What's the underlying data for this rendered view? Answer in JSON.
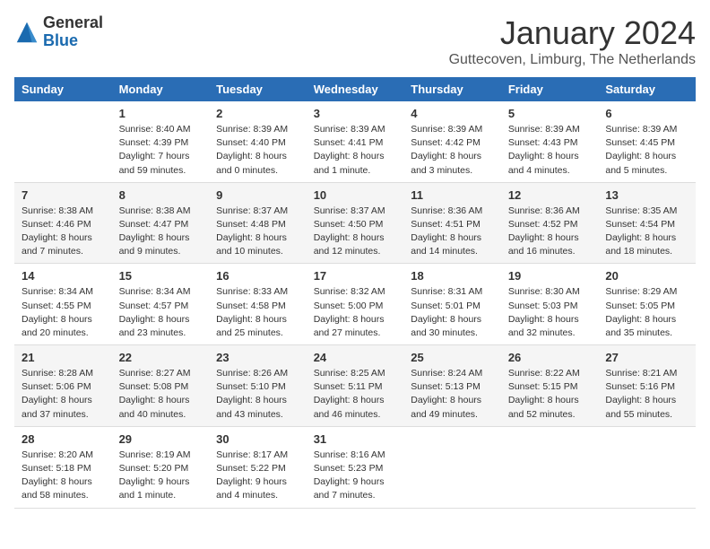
{
  "logo": {
    "general": "General",
    "blue": "Blue"
  },
  "title": "January 2024",
  "location": "Guttecoven, Limburg, The Netherlands",
  "days_header": [
    "Sunday",
    "Monday",
    "Tuesday",
    "Wednesday",
    "Thursday",
    "Friday",
    "Saturday"
  ],
  "weeks": [
    [
      {
        "num": "",
        "info": ""
      },
      {
        "num": "1",
        "info": "Sunrise: 8:40 AM\nSunset: 4:39 PM\nDaylight: 7 hours\nand 59 minutes."
      },
      {
        "num": "2",
        "info": "Sunrise: 8:39 AM\nSunset: 4:40 PM\nDaylight: 8 hours\nand 0 minutes."
      },
      {
        "num": "3",
        "info": "Sunrise: 8:39 AM\nSunset: 4:41 PM\nDaylight: 8 hours\nand 1 minute."
      },
      {
        "num": "4",
        "info": "Sunrise: 8:39 AM\nSunset: 4:42 PM\nDaylight: 8 hours\nand 3 minutes."
      },
      {
        "num": "5",
        "info": "Sunrise: 8:39 AM\nSunset: 4:43 PM\nDaylight: 8 hours\nand 4 minutes."
      },
      {
        "num": "6",
        "info": "Sunrise: 8:39 AM\nSunset: 4:45 PM\nDaylight: 8 hours\nand 5 minutes."
      }
    ],
    [
      {
        "num": "7",
        "info": "Sunrise: 8:38 AM\nSunset: 4:46 PM\nDaylight: 8 hours\nand 7 minutes."
      },
      {
        "num": "8",
        "info": "Sunrise: 8:38 AM\nSunset: 4:47 PM\nDaylight: 8 hours\nand 9 minutes."
      },
      {
        "num": "9",
        "info": "Sunrise: 8:37 AM\nSunset: 4:48 PM\nDaylight: 8 hours\nand 10 minutes."
      },
      {
        "num": "10",
        "info": "Sunrise: 8:37 AM\nSunset: 4:50 PM\nDaylight: 8 hours\nand 12 minutes."
      },
      {
        "num": "11",
        "info": "Sunrise: 8:36 AM\nSunset: 4:51 PM\nDaylight: 8 hours\nand 14 minutes."
      },
      {
        "num": "12",
        "info": "Sunrise: 8:36 AM\nSunset: 4:52 PM\nDaylight: 8 hours\nand 16 minutes."
      },
      {
        "num": "13",
        "info": "Sunrise: 8:35 AM\nSunset: 4:54 PM\nDaylight: 8 hours\nand 18 minutes."
      }
    ],
    [
      {
        "num": "14",
        "info": "Sunrise: 8:34 AM\nSunset: 4:55 PM\nDaylight: 8 hours\nand 20 minutes."
      },
      {
        "num": "15",
        "info": "Sunrise: 8:34 AM\nSunset: 4:57 PM\nDaylight: 8 hours\nand 23 minutes."
      },
      {
        "num": "16",
        "info": "Sunrise: 8:33 AM\nSunset: 4:58 PM\nDaylight: 8 hours\nand 25 minutes."
      },
      {
        "num": "17",
        "info": "Sunrise: 8:32 AM\nSunset: 5:00 PM\nDaylight: 8 hours\nand 27 minutes."
      },
      {
        "num": "18",
        "info": "Sunrise: 8:31 AM\nSunset: 5:01 PM\nDaylight: 8 hours\nand 30 minutes."
      },
      {
        "num": "19",
        "info": "Sunrise: 8:30 AM\nSunset: 5:03 PM\nDaylight: 8 hours\nand 32 minutes."
      },
      {
        "num": "20",
        "info": "Sunrise: 8:29 AM\nSunset: 5:05 PM\nDaylight: 8 hours\nand 35 minutes."
      }
    ],
    [
      {
        "num": "21",
        "info": "Sunrise: 8:28 AM\nSunset: 5:06 PM\nDaylight: 8 hours\nand 37 minutes."
      },
      {
        "num": "22",
        "info": "Sunrise: 8:27 AM\nSunset: 5:08 PM\nDaylight: 8 hours\nand 40 minutes."
      },
      {
        "num": "23",
        "info": "Sunrise: 8:26 AM\nSunset: 5:10 PM\nDaylight: 8 hours\nand 43 minutes."
      },
      {
        "num": "24",
        "info": "Sunrise: 8:25 AM\nSunset: 5:11 PM\nDaylight: 8 hours\nand 46 minutes."
      },
      {
        "num": "25",
        "info": "Sunrise: 8:24 AM\nSunset: 5:13 PM\nDaylight: 8 hours\nand 49 minutes."
      },
      {
        "num": "26",
        "info": "Sunrise: 8:22 AM\nSunset: 5:15 PM\nDaylight: 8 hours\nand 52 minutes."
      },
      {
        "num": "27",
        "info": "Sunrise: 8:21 AM\nSunset: 5:16 PM\nDaylight: 8 hours\nand 55 minutes."
      }
    ],
    [
      {
        "num": "28",
        "info": "Sunrise: 8:20 AM\nSunset: 5:18 PM\nDaylight: 8 hours\nand 58 minutes."
      },
      {
        "num": "29",
        "info": "Sunrise: 8:19 AM\nSunset: 5:20 PM\nDaylight: 9 hours\nand 1 minute."
      },
      {
        "num": "30",
        "info": "Sunrise: 8:17 AM\nSunset: 5:22 PM\nDaylight: 9 hours\nand 4 minutes."
      },
      {
        "num": "31",
        "info": "Sunrise: 8:16 AM\nSunset: 5:23 PM\nDaylight: 9 hours\nand 7 minutes."
      },
      {
        "num": "",
        "info": ""
      },
      {
        "num": "",
        "info": ""
      },
      {
        "num": "",
        "info": ""
      }
    ]
  ]
}
